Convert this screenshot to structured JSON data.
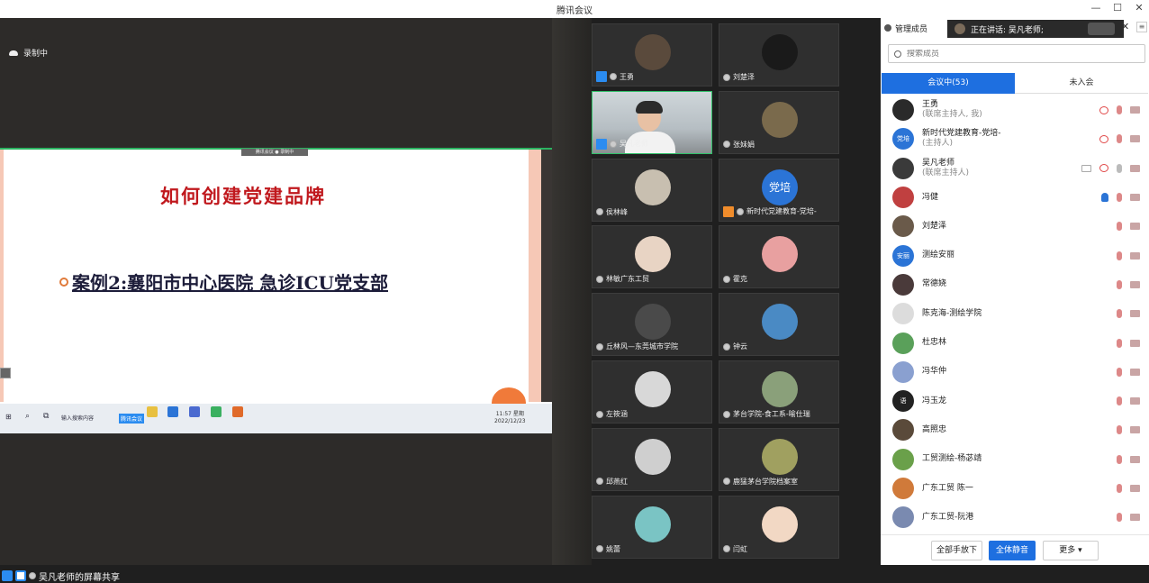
{
  "window": {
    "title": "腾讯会议",
    "minimize": "—",
    "maximize": "☐",
    "close": "✕"
  },
  "recording": {
    "label": "录制中"
  },
  "share": {
    "tag": "腾讯会议 ● 录制中",
    "slide_title": "如何创建党建品牌",
    "case_text": "案例2:襄阳市中心医院   急诊ICU党支部",
    "taskbar": {
      "start": "⊞",
      "search": "⌕",
      "task": "⧉",
      "browser": "输入搜索内容",
      "active_app": "腾讯会议",
      "clock_time": "11:57 星期",
      "clock_date": "2022/12/23"
    },
    "presenter_label": "吴凡老师的屏幕共享"
  },
  "tiles": [
    {
      "name": "王勇",
      "host": true,
      "color": "#5a4a3c"
    },
    {
      "name": "刘楚泽",
      "host": false,
      "color": "#1a1a1a"
    },
    {
      "name": "吴凡老师",
      "host": true,
      "video": true
    },
    {
      "name": "张妹娟",
      "host": false,
      "color": "#7a6a4c"
    },
    {
      "name": "侯林峰",
      "host": false,
      "color": "#c8bfb0"
    },
    {
      "name": "新时代党建教育-党培-",
      "host": true,
      "cohost": true,
      "badge": "党培"
    },
    {
      "name": "林敏广东工贸",
      "host": false,
      "color": "#e8d4c4"
    },
    {
      "name": "霍克",
      "host": false,
      "color": "#e8a0a0"
    },
    {
      "name": "丘林风—东莞城市学院",
      "host": false,
      "color": "#4a4a4a"
    },
    {
      "name": "钟云",
      "host": false,
      "color": "#4a8ac4"
    },
    {
      "name": "左筱涵",
      "host": false,
      "color": "#d8d8d8"
    },
    {
      "name": "茅台学院-食工系-喻仕瑞",
      "host": false,
      "color": "#8aa07a"
    },
    {
      "name": "邱燕红",
      "host": false,
      "color": "#cfcfcf"
    },
    {
      "name": "鹿猛茅台学院档案室",
      "host": false,
      "color": "#a0a060"
    },
    {
      "name": "姚蕾",
      "host": false,
      "color": "#7ac4c4"
    },
    {
      "name": "闫虹",
      "host": false,
      "color": "#f2d8c4"
    }
  ],
  "panel": {
    "header": "管理成员",
    "speaking": "正在讲话: 吴凡老师;",
    "close": "✕",
    "menu": "≡",
    "search_placeholder": "搜索成员",
    "tab_in": "会议中(53)",
    "tab_out": "未入会",
    "members": [
      {
        "name": "王勇",
        "sub": "(联席主持人, 我)",
        "color": "#2a2a2a",
        "icons": [
          "eye",
          "mic-off",
          "cam-off"
        ]
      },
      {
        "name": "新时代党建教育-党培-",
        "sub": "(主持人)",
        "color": "#2b74d6",
        "badge": "党培",
        "icons": [
          "eye",
          "mic-off",
          "cam-off"
        ]
      },
      {
        "name": "吴凡老师",
        "sub": "(联席主持人)",
        "color": "#3a3a3a",
        "icons": [
          "screen",
          "eye",
          "mic",
          "cam-off"
        ]
      },
      {
        "name": "冯健",
        "sub": "",
        "color": "#c04040",
        "icons": [
          "hand",
          "mic-off",
          "cam-off"
        ]
      },
      {
        "name": "刘楚泽",
        "sub": "",
        "color": "#6a5a4a",
        "icons": [
          "mic-off",
          "cam-off"
        ]
      },
      {
        "name": "测绘安丽",
        "sub": "",
        "color": "#2b74d6",
        "badge": "安丽",
        "icons": [
          "mic-off",
          "cam-off"
        ]
      },
      {
        "name": "常德娆",
        "sub": "",
        "color": "#4a3a3a",
        "icons": [
          "mic-off",
          "cam-off"
        ]
      },
      {
        "name": "陈克海-测绘学院",
        "sub": "",
        "color": "#dcdcdc",
        "icons": [
          "mic-off",
          "cam-off"
        ]
      },
      {
        "name": "杜忠林",
        "sub": "",
        "color": "#5aa05a",
        "icons": [
          "mic-off",
          "cam-off"
        ]
      },
      {
        "name": "冯华仲",
        "sub": "",
        "color": "#8aa0d0",
        "icons": [
          "mic-off",
          "cam-off"
        ]
      },
      {
        "name": "冯玉龙",
        "sub": "",
        "color": "#222222",
        "badge": "语",
        "icons": [
          "mic-off",
          "cam-off"
        ]
      },
      {
        "name": "高照忠",
        "sub": "",
        "color": "#5a4a3a",
        "icons": [
          "mic-off",
          "cam-off"
        ]
      },
      {
        "name": "工贸测绘-杨苾靖",
        "sub": "",
        "color": "#6aa04a",
        "icons": [
          "mic-off",
          "cam-off"
        ]
      },
      {
        "name": "广东工贸 陈一",
        "sub": "",
        "color": "#d07a3a",
        "icons": [
          "mic-off",
          "cam-off"
        ]
      },
      {
        "name": "广东工贸-阮港",
        "sub": "",
        "color": "#7a8ab0",
        "icons": [
          "mic-off",
          "cam-off"
        ]
      }
    ],
    "btn_lower_all": "全部手放下",
    "btn_mute_all": "全体静音",
    "btn_more": "更多 ▾"
  }
}
